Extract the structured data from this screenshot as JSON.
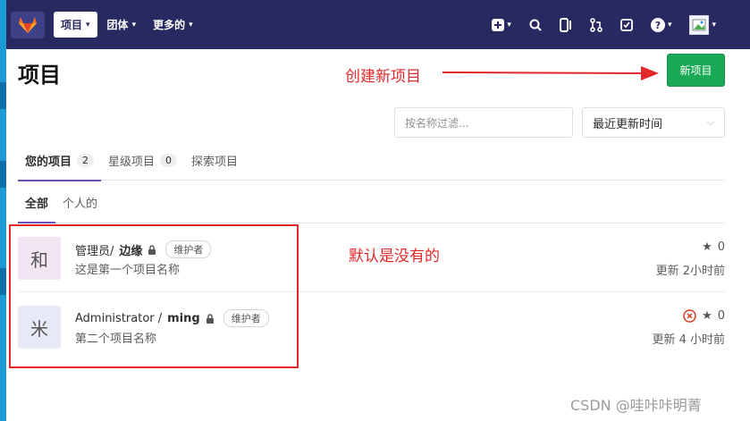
{
  "navbar": {
    "logo": "gitlab-logo",
    "menu": [
      {
        "label": "项目",
        "active": true
      },
      {
        "label": "团体",
        "active": false
      },
      {
        "label": "更多的",
        "active": false
      }
    ],
    "icons": [
      "plus-icon",
      "search-icon",
      "issues-icon",
      "merge-request-icon",
      "todo-icon",
      "help-icon",
      "user-avatar"
    ]
  },
  "page": {
    "title": "项目",
    "new_button": "新项目",
    "filter_placeholder": "按名称过滤...",
    "sort_value": "最近更新时间"
  },
  "annotations": {
    "create_label": "创建新项目",
    "default_label": "默认是没有的",
    "color": "#e0282b"
  },
  "tabs": [
    {
      "label": "您的项目",
      "count": "2",
      "active": true
    },
    {
      "label": "星级项目",
      "count": "0",
      "active": false
    },
    {
      "label": "探索项目",
      "count": "",
      "active": false
    }
  ],
  "subtabs": [
    {
      "label": "全部",
      "active": true
    },
    {
      "label": "个人的",
      "active": false
    }
  ],
  "projects": [
    {
      "avatar_letter": "和",
      "avatar_bg": "#f3e6f3",
      "namespace": "管理员/",
      "name": "边缘",
      "role": "维护者",
      "description": "这是第一个项目名称",
      "stars": "0",
      "updated": "更新 2小时前",
      "failed": false
    },
    {
      "avatar_letter": "米",
      "avatar_bg": "#e7e9f6",
      "namespace": "Administrator /",
      "name": "ming",
      "role": "维护者",
      "description": "第二个项目名称",
      "stars": "0",
      "updated": "更新 4 小时前",
      "failed": true
    }
  ],
  "watermark": "CSDN @哇咔咔明菁"
}
